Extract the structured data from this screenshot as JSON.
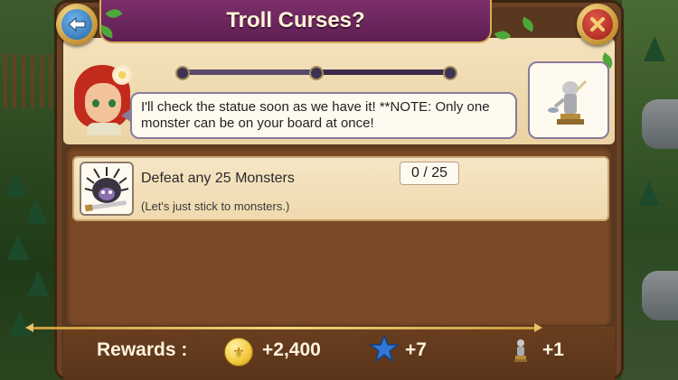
{
  "header": {
    "title": "Troll Curses?"
  },
  "dialog": {
    "text": "I'll check the statue soon as we have it! **NOTE: Only one monster can be on your board at once!"
  },
  "quest_progress_fraction": 0.5,
  "task": {
    "title": "Defeat any 25 Monsters",
    "subtitle": "(Let's just stick to monsters.)",
    "progress": "0 / 25"
  },
  "rewards": {
    "label": "Rewards :",
    "coins": "+2,400",
    "stars": "+7",
    "items": "+1"
  },
  "colors": {
    "banner": "#6a2560",
    "panel": "#6b4324",
    "parchment": "#f1ddb3"
  },
  "icons": {
    "back": "back-arrow-icon",
    "close": "close-x-icon",
    "coin": "fleur-de-lis-coin-icon",
    "star": "blue-star-icon",
    "statue": "statue-icon",
    "monster": "porcupine-monster-icon"
  }
}
